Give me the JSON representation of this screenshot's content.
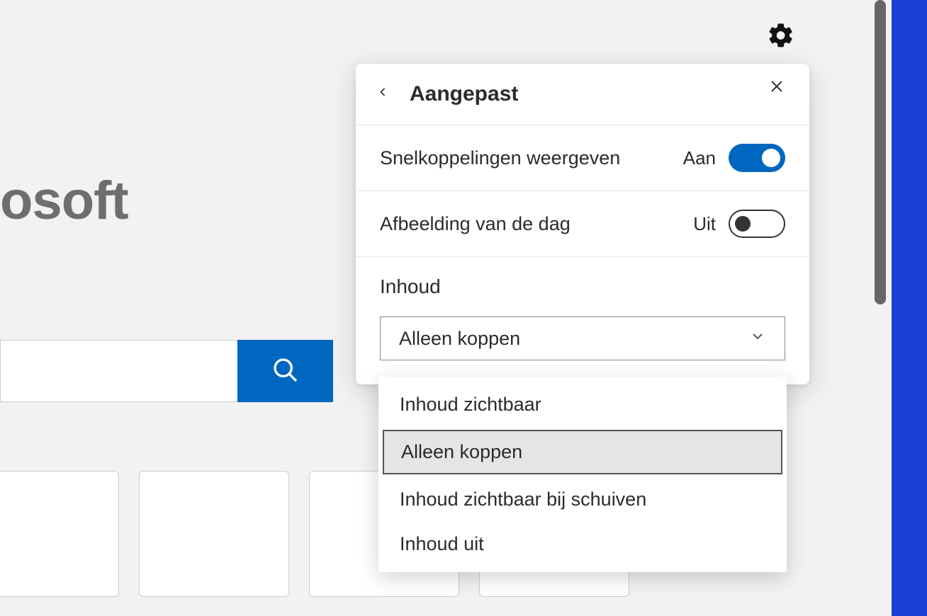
{
  "brand_fragment": "osoft",
  "panel": {
    "title": "Aangepast",
    "settings": [
      {
        "label": "Snelkoppelingen weergeven",
        "state": "Aan",
        "on": true
      },
      {
        "label": "Afbeelding van de dag",
        "state": "Uit",
        "on": false
      }
    ],
    "content_label": "Inhoud",
    "select_value": "Alleen koppen",
    "dropdown_options": [
      "Inhoud zichtbaar",
      "Alleen koppen",
      "Inhoud zichtbaar bij schuiven",
      "Inhoud uit"
    ],
    "selected_index": 1
  }
}
